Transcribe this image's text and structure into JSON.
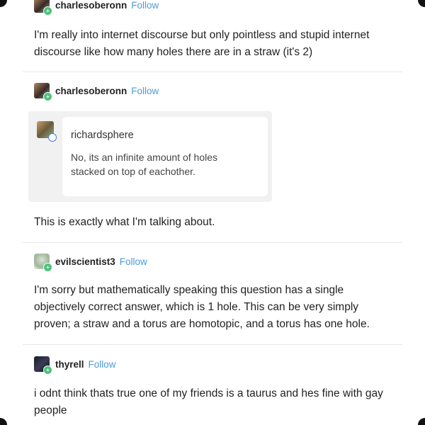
{
  "posts": [
    {
      "username": "charlesoberonn",
      "follow": "Follow",
      "text": "I'm really into internet discourse but only pointless and stupid internet discourse like how many holes there are in a straw (it's 2)"
    },
    {
      "username": "charlesoberonn",
      "follow": "Follow",
      "quote": {
        "username": "richardsphere",
        "text": "No, its an infinite amount of holes stacked on top of eachother."
      },
      "text": "This is exactly what I'm talking about."
    },
    {
      "username": "evilscientist3",
      "follow": "Follow",
      "text": "I'm sorry but mathematically speaking this question has a single objectively correct answer, which is 1 hole. This can be very simply proven; a straw and a torus are homotopic, and a torus has one hole."
    },
    {
      "username": "thyrell",
      "follow": "Follow",
      "text": "i odnt think thats true one of my friends is a taurus and hes fine with gay people"
    }
  ],
  "colors": {
    "follow": "#4a9bd6",
    "badge": "#4cc27a",
    "divider": "#e6e6e6"
  },
  "icons": [
    "user-avatar-icon",
    "follow-badge-icon",
    "quote-avatar-icon"
  ]
}
